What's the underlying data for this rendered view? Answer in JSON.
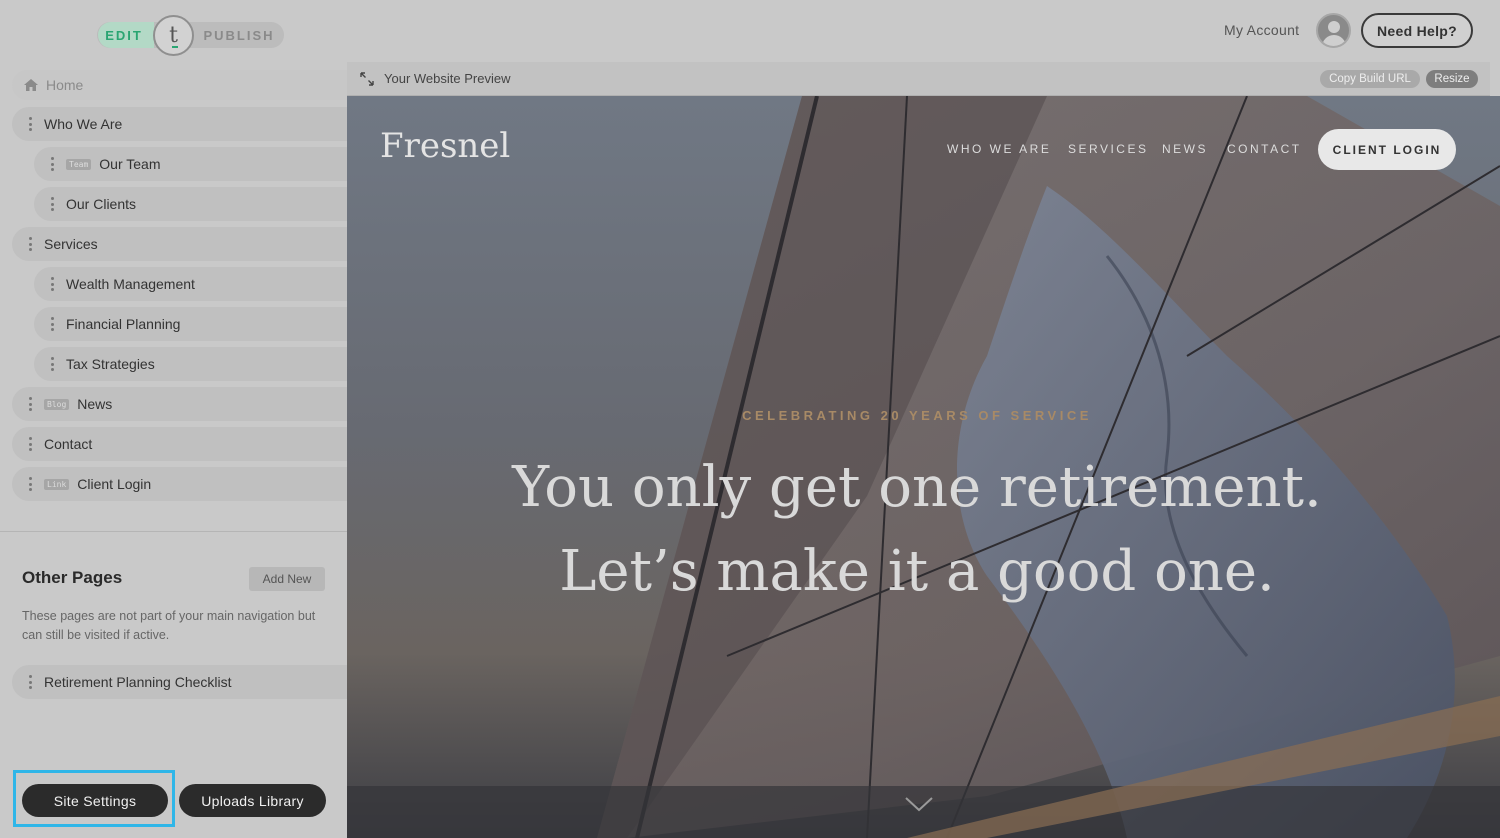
{
  "topbar": {
    "edit_label": "EDIT",
    "publish_label": "PUBLISH",
    "logo_letter": "t",
    "my_account": "My Account",
    "need_help": "Need Help?"
  },
  "sidebar": {
    "home": "Home",
    "items": [
      {
        "label": "Who We Are",
        "tag": "",
        "sub": false
      },
      {
        "label": "Our Team",
        "tag": "Team",
        "sub": true
      },
      {
        "label": "Our Clients",
        "tag": "",
        "sub": true
      },
      {
        "label": "Services",
        "tag": "",
        "sub": false
      },
      {
        "label": "Wealth Management",
        "tag": "",
        "sub": true
      },
      {
        "label": "Financial Planning",
        "tag": "",
        "sub": true
      },
      {
        "label": "Tax Strategies",
        "tag": "",
        "sub": true
      },
      {
        "label": "News",
        "tag": "Blog",
        "sub": false
      },
      {
        "label": "Contact",
        "tag": "",
        "sub": false
      },
      {
        "label": "Client Login",
        "tag": "Link",
        "sub": false
      }
    ],
    "other_pages": {
      "title": "Other Pages",
      "add_new": "Add New",
      "description": "These pages are not part of your main navigation but can still be visited if active.",
      "items": [
        {
          "label": "Retirement Planning Checklist"
        }
      ]
    },
    "site_settings": "Site Settings",
    "uploads_library": "Uploads Library"
  },
  "preview": {
    "title": "Your Website Preview",
    "copy_build_url": "Copy Build URL",
    "resize": "Resize"
  },
  "site": {
    "logo": "Fresnel",
    "nav": [
      "WHO WE ARE",
      "SERVICES",
      "NEWS",
      "CONTACT"
    ],
    "client_login": "CLIENT LOGIN",
    "kicker": "CELEBRATING 20 YEARS OF SERVICE",
    "headline_line1": "You only get one retirement.",
    "headline_line2": "Let’s make it a good one."
  },
  "colors": {
    "edit_accent": "#2aa572",
    "focus_ring": "#2fb6e8",
    "kicker": "#a88a66"
  }
}
